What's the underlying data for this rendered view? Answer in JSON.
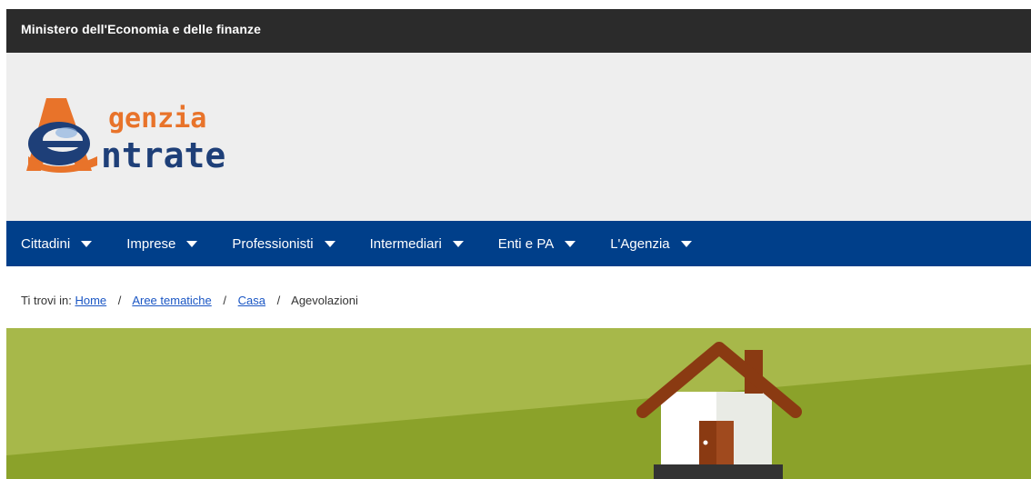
{
  "ministry_bar": {
    "title": "Ministero dell'Economia e delle finanze"
  },
  "logo": {
    "line1": "genzia",
    "line2": "ntrate",
    "colors": {
      "orange": "#e8732a",
      "blue": "#1e3f78"
    }
  },
  "nav": {
    "items": [
      {
        "label": "Cittadini"
      },
      {
        "label": "Imprese"
      },
      {
        "label": "Professionisti"
      },
      {
        "label": "Intermediari"
      },
      {
        "label": "Enti e PA"
      },
      {
        "label": "L'Agenzia"
      }
    ]
  },
  "breadcrumb": {
    "prefix": "Ti trovi in:",
    "links": [
      "Home",
      "Aree tematiche",
      "Casa"
    ],
    "separator": "/",
    "current": "Agevolazioni"
  },
  "hero": {
    "illustration": "house-illustration",
    "colors": {
      "light_green": "#a7b84a",
      "dark_green": "#8ba22a"
    }
  },
  "colors": {
    "top_bar": "#2b2b2b",
    "header_bg": "#eeeeee",
    "nav_bg": "#003f8a",
    "link": "#1a56c4"
  }
}
